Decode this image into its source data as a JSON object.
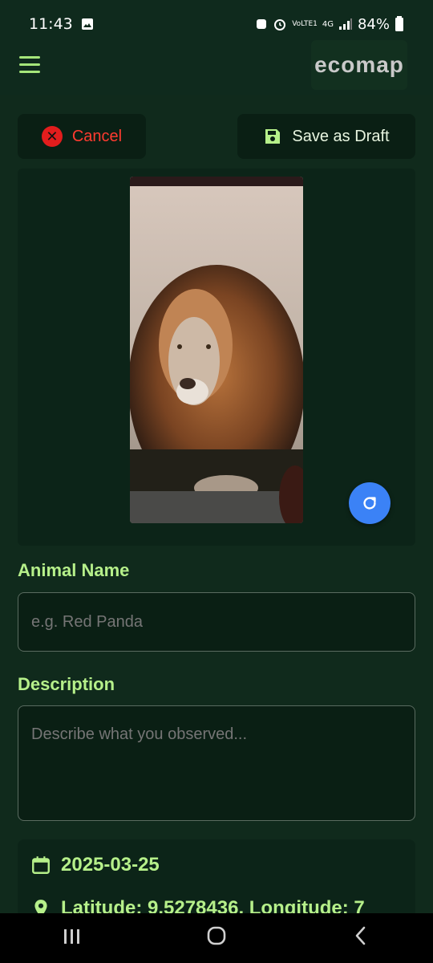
{
  "status_bar": {
    "time": "11:43",
    "network": "4G",
    "carrier_badge": "VoLTE1",
    "battery": "84%"
  },
  "app_bar": {
    "logo_text": "ecomap"
  },
  "actions": {
    "cancel_label": "Cancel",
    "save_draft_label": "Save as Draft"
  },
  "form": {
    "animal_name_label": "Animal Name",
    "animal_name_placeholder": "e.g. Red Panda",
    "animal_name_value": "",
    "description_label": "Description",
    "description_placeholder": "Describe what you observed...",
    "description_value": ""
  },
  "info": {
    "date": "2025-03-25",
    "location": "Latitude: 9.5278436, Longitude: 7"
  },
  "colors": {
    "background": "#0f2a1d",
    "accent": "#b6f08a",
    "cancel": "#ff3b30",
    "refresh": "#3b82f6"
  }
}
